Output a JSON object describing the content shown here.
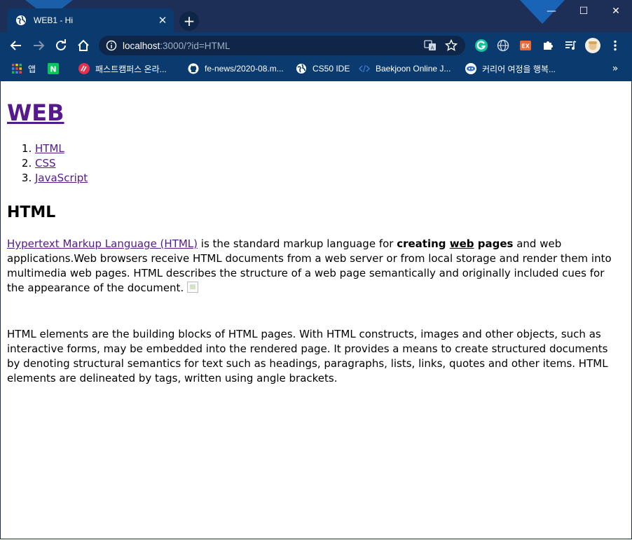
{
  "browser": {
    "tab_title": "WEB1 - Hi",
    "tab_close": "✕",
    "new_tab": "+",
    "window_controls": {
      "minimize": "—",
      "maximize": "☐",
      "close": "✕"
    },
    "url_host": "localhost",
    "url_rest": ":3000/?id=HTML",
    "bookmarks": [
      {
        "label": "앱",
        "icon": "apps-grid-icon"
      },
      {
        "label": "",
        "icon": "naver-icon",
        "icon_text": "N"
      },
      {
        "label": "패스트캠퍼스 온라...",
        "icon": "fastcampus-icon"
      },
      {
        "label": "fe-news/2020-08.m...",
        "icon": "github-icon"
      },
      {
        "label": "CS50 IDE",
        "icon": "globe-icon"
      },
      {
        "label": "Baekjoon Online J...",
        "icon": "code-icon"
      },
      {
        "label": "커리어 여정을 행복...",
        "icon": "career-icon"
      }
    ],
    "bookmarks_more": "»",
    "extension_labels": {
      "ex": "EX"
    },
    "colors": {
      "titlebar": "#1d2f57",
      "toolbar": "#0b3b6e",
      "link_visited": "#551a8b"
    }
  },
  "page": {
    "site_title": "WEB",
    "nav": [
      "HTML",
      "CSS",
      "JavaScript"
    ],
    "heading": "HTML",
    "p1": {
      "link": "Hypertext Markup Language (HTML)",
      "t1": " is the standard markup language for ",
      "b1": "creating ",
      "b2": "web",
      "b3": " pages",
      "t2": " and web applications.Web browsers receive HTML documents from a web server or from local storage and render them into multimedia web pages. HTML describes the structure of a web page semantically and originally included cues for the appearance of the document. "
    },
    "p2": "HTML elements are the building blocks of HTML pages. With HTML constructs, images and other objects, such as interactive forms, may be embedded into the rendered page. It provides a means to create structured documents by denoting structural semantics for text such as headings, paragraphs, lists, links, quotes and other items. HTML elements are delineated by tags, written using angle brackets."
  }
}
